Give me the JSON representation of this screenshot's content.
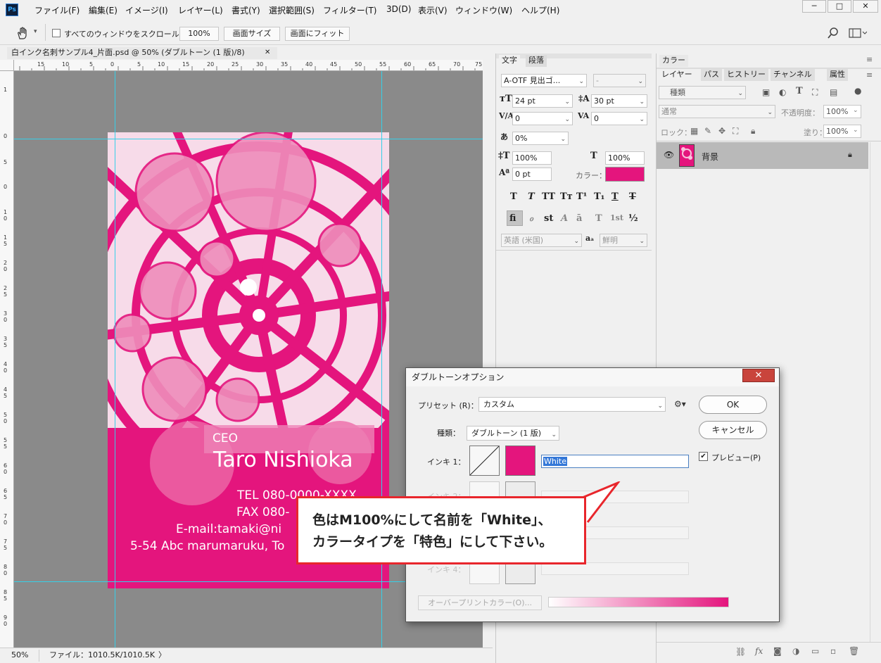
{
  "menu": {
    "logo": "Ps",
    "items": [
      "ファイル(F)",
      "編集(E)",
      "イメージ(I)",
      "レイヤー(L)",
      "書式(Y)",
      "選択範囲(S)",
      "フィルター(T)",
      "3D(D)",
      "表示(V)",
      "ウィンドウ(W)",
      "ヘルプ(H)"
    ],
    "win_min": "─",
    "win_max": "□",
    "win_close": "✕"
  },
  "options": {
    "hand_dropdown": "▾",
    "scroll_all_label": "すべてのウィンドウをスクロール",
    "zoom": "100%",
    "fit_screen": "画面サイズ",
    "fill_screen": "画面にフィット"
  },
  "document": {
    "tab_title": "白インク名刺サンプル4_片面.psd @ 50% (ダブルトーン (1 版)/8)",
    "tab_close": "✕",
    "ruler_h": [
      "15",
      "10",
      "5",
      "0",
      "5",
      "10",
      "15",
      "20",
      "25",
      "30",
      "35",
      "40",
      "45",
      "50",
      "55",
      "60",
      "65",
      "70",
      "75"
    ],
    "ruler_v": [
      "1",
      "0",
      "5",
      "0",
      "5",
      "1 0",
      "1 5",
      "2 0",
      "2 5",
      "3 0",
      "3 5",
      "4 0",
      "4 5",
      "5 0",
      "5 5",
      "6 0",
      "6 5",
      "7 0",
      "7 5",
      "8 0",
      "8 5",
      "9 0",
      "9 5"
    ],
    "card": {
      "title": "CEO",
      "name": "Taro Nishioka",
      "tel": "TEL 080-0000-XXXX",
      "fax": "FAX 080-",
      "email": "E-mail:tamaki@ni",
      "address": "5-54 Abc marumaruku, To"
    }
  },
  "status": {
    "zoom": "50%",
    "file": "ファイル：1010.5K/1010.5K",
    "arrow": "〉"
  },
  "char_panel": {
    "tabs": [
      "文字",
      "段落"
    ],
    "font_family": "A-OTF 見出ゴ...",
    "font_style": "-",
    "size": "24 pt",
    "leading": "30 pt",
    "kerning": "0",
    "tracking": "0",
    "tsume": "0%",
    "vscale": "100%",
    "hscale": "100%",
    "baseline": "0 pt",
    "color_label": "カラー：",
    "color": "#e4157d",
    "style_glyphs": [
      "T",
      "T",
      "TT",
      "Tт",
      "T¹",
      "T₁",
      "T",
      "T"
    ],
    "opentype_glyphs": [
      "fi",
      "ℴ",
      "st",
      "A",
      "ā",
      "T",
      "1st",
      "½"
    ],
    "language": "英語 (米国)",
    "aa": "鮮明"
  },
  "layers_panel": {
    "top_tab": "カラー",
    "tabs": [
      "レイヤー",
      "パス",
      "ヒストリー",
      "チャンネル",
      "属性"
    ],
    "kind": "種類",
    "blend": "通常",
    "opacity_label": "不透明度：",
    "opacity": "100%",
    "lock_label": "ロック：",
    "fill_label": "塗り：",
    "fill": "100%",
    "layer_name": "背景"
  },
  "dialog": {
    "title": "ダブルトーンオプション",
    "close": "✕",
    "preset_label": "プリセット (R)：",
    "preset_value": "カスタム",
    "type_label": "種類：",
    "type_value": "ダブルトーン (1 版)",
    "ink1_label": "インキ 1：",
    "ink1_name": "White",
    "ink1_color": "#e4157d",
    "ink2_label": "インキ 2：",
    "ink4_label": "インキ 4：",
    "ok": "OK",
    "cancel": "キャンセル",
    "preview_label": "プレビュー(P)",
    "overprint": "オーバープリントカラー(O)..."
  },
  "callout": {
    "line1": "色はM100%にして名前を「White」、",
    "line2": "カラータイプを「特色」にして下さい。"
  }
}
